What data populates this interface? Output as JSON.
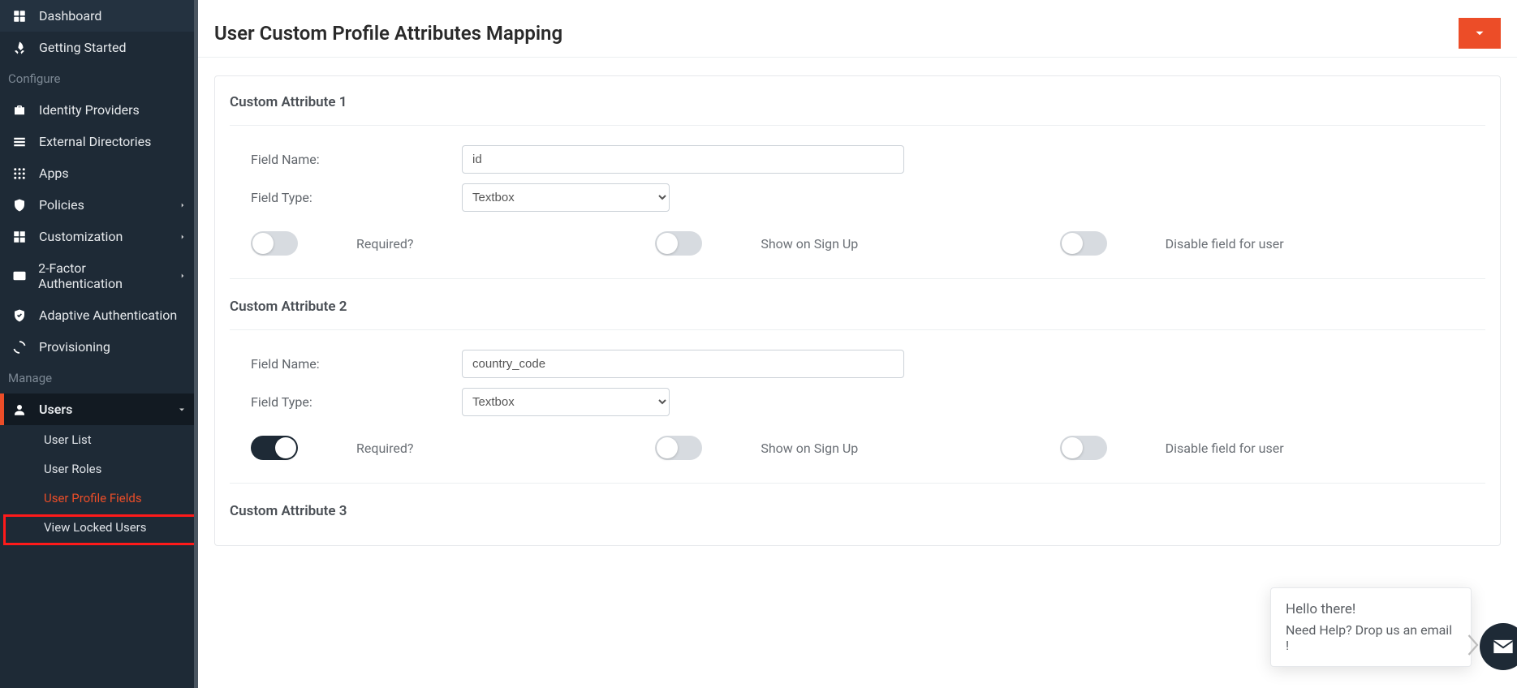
{
  "sidebar": {
    "top_items": [
      {
        "label": "Dashboard"
      },
      {
        "label": "Getting Started"
      }
    ],
    "section1_title": "Configure",
    "configure_items": [
      {
        "label": "Identity Providers"
      },
      {
        "label": "External Directories"
      },
      {
        "label": "Apps"
      },
      {
        "label": "Policies",
        "chevron": true
      },
      {
        "label": "Customization",
        "chevron": true
      },
      {
        "label": "2-Factor Authentication",
        "chevron": true
      },
      {
        "label": "Adaptive Authentication"
      },
      {
        "label": "Provisioning"
      }
    ],
    "section2_title": "Manage",
    "users_label": "Users",
    "sub_items": [
      {
        "label": "User List"
      },
      {
        "label": "User Roles"
      },
      {
        "label": "User Profile Fields"
      },
      {
        "label": "View Locked Users"
      }
    ]
  },
  "page_title": "User Custom Profile Attributes Mapping",
  "labels": {
    "field_name": "Field Name:",
    "field_type": "Field Type:",
    "required": "Required?",
    "show_on_signup": "Show on Sign Up",
    "disable_field": "Disable field for user"
  },
  "field_type_options": [
    "Textbox"
  ],
  "attributes": [
    {
      "title": "Custom Attribute 1",
      "field_name_value": "id",
      "field_type_value": "Textbox",
      "required": false,
      "show": false,
      "disable": false
    },
    {
      "title": "Custom Attribute 2",
      "field_name_value": "country_code",
      "field_type_value": "Textbox",
      "required": true,
      "show": false,
      "disable": false
    },
    {
      "title": "Custom Attribute 3"
    }
  ],
  "help": {
    "title": "Hello there!",
    "subtitle": "Need Help? Drop us an email !"
  }
}
